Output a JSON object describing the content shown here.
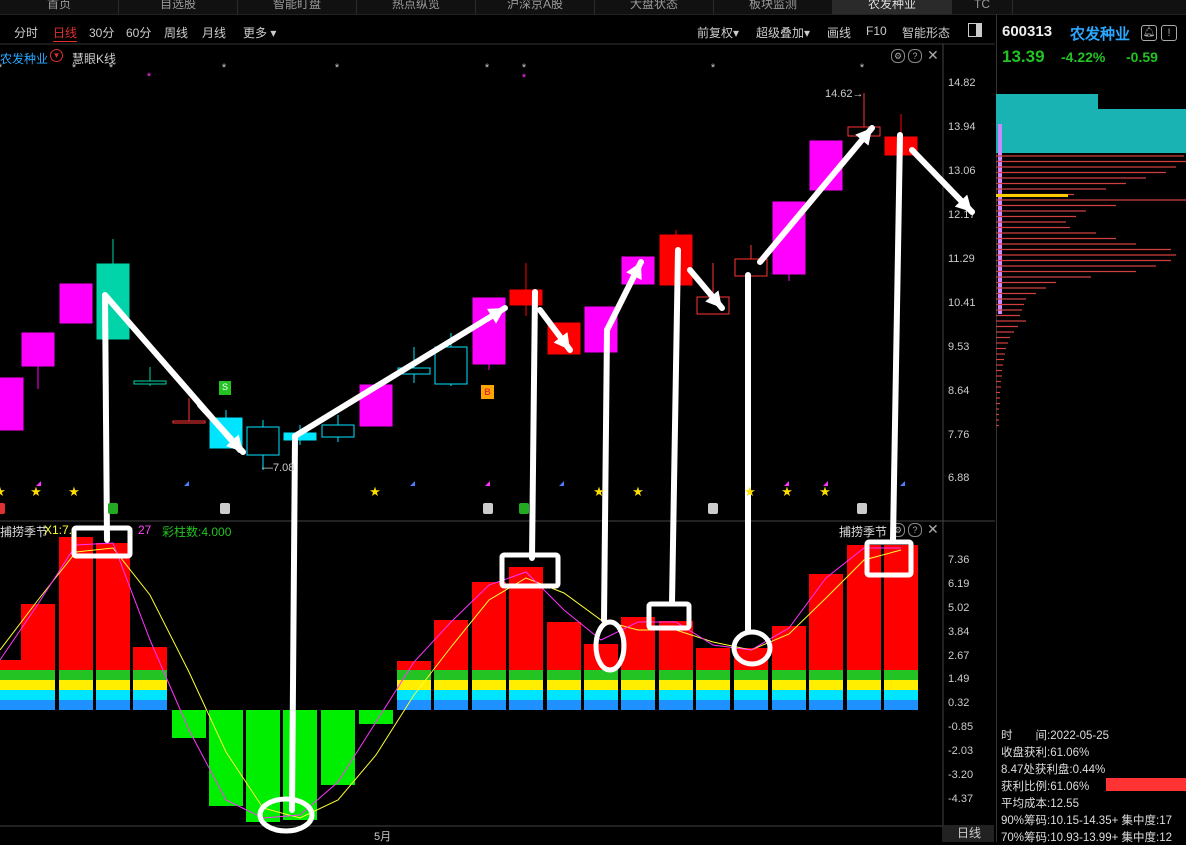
{
  "tabs": [
    "首页",
    "自选股",
    "智能盯盘",
    "热点纵览",
    "沪深京A股",
    "大盘状态",
    "板块监测",
    "农发种业",
    "TC"
  ],
  "toolbar": {
    "left": [
      "分时",
      "日线",
      "30分",
      "60分",
      "周线",
      "月线",
      "更多"
    ],
    "active": "日线",
    "right": [
      "前复权",
      "超级叠加",
      "画线",
      "F10",
      "智能形态"
    ]
  },
  "main_chart": {
    "stock_label": "农发种业",
    "indicator": "慧眼K线",
    "y_ticks": [
      "14.82",
      "13.94",
      "13.06",
      "12.17",
      "11.29",
      "10.41",
      "9.53",
      "8.64",
      "7.76",
      "6.88"
    ],
    "high_label": "14.62→",
    "low_label": "—7.08",
    "markers": {
      "s": "S",
      "b": "B"
    }
  },
  "sub_chart": {
    "title": "捕捞季节",
    "x1_label": "X1:7.",
    "x2_label": "27",
    "caizhu": "彩柱数:4.000",
    "title_right": "捕捞季节",
    "y_ticks": [
      "7.36",
      "6.19",
      "5.02",
      "3.84",
      "2.67",
      "1.49",
      "0.32",
      "-0.85",
      "-2.03",
      "-3.20",
      "-4.37"
    ],
    "month_label": "5月",
    "period_label": "日线"
  },
  "quote": {
    "code": "600313",
    "name": "农发种业",
    "price": "13.39",
    "pct": "-4.22%",
    "change": "-0.59"
  },
  "chip_info": {
    "time": "时　　间:2022-05-25",
    "profit": "收盘获利:61.06%",
    "at_price": "8.47处获利盘:0.44%",
    "ratio": "获利比例:61.06%",
    "avg_cost": "平均成本:12.55",
    "chip90": "90%筹码:10.15-14.35+ 集中度:17",
    "chip70": "70%筹码:10.93-13.99+ 集中度:12"
  },
  "colors": {
    "up": "#ff0000",
    "down": "#22c322",
    "magenta": "#ff00ff",
    "cyan": "#00e5ff",
    "name": "#2aa8ff"
  }
}
